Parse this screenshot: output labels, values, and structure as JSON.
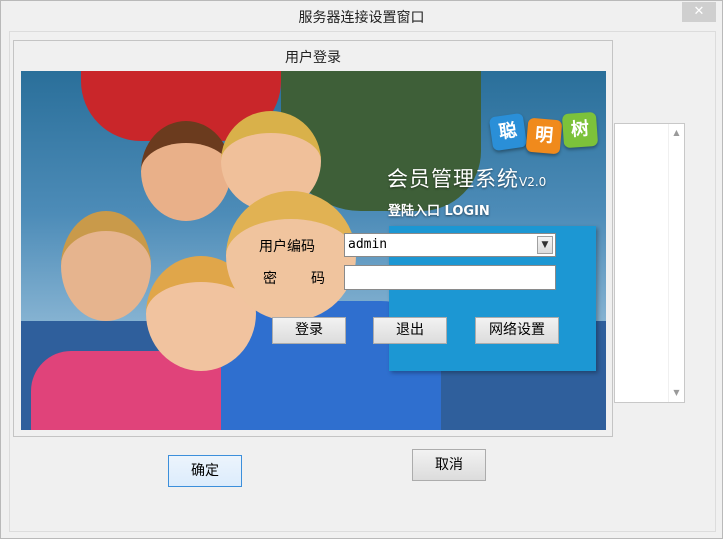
{
  "window": {
    "title": "服务器连接设置窗口",
    "close_label": "✕"
  },
  "login_panel": {
    "title": "用户登录",
    "system_name": "会员管理系统",
    "system_version": "V2.0",
    "login_entry": "登陆入口 LOGIN",
    "logo_chars": [
      "聪",
      "明",
      "树"
    ],
    "username_label": "用户编码",
    "username_value": "admin",
    "password_label_1": "密",
    "password_label_2": "码",
    "password_value": "",
    "login_button": "登录",
    "exit_button": "退出",
    "network_button": "网络设置"
  },
  "dialog": {
    "ok_button": "确定",
    "cancel_button": "取消"
  },
  "colors": {
    "accent_blue": "#1c97d3",
    "focus_border": "#3c8fdb"
  }
}
